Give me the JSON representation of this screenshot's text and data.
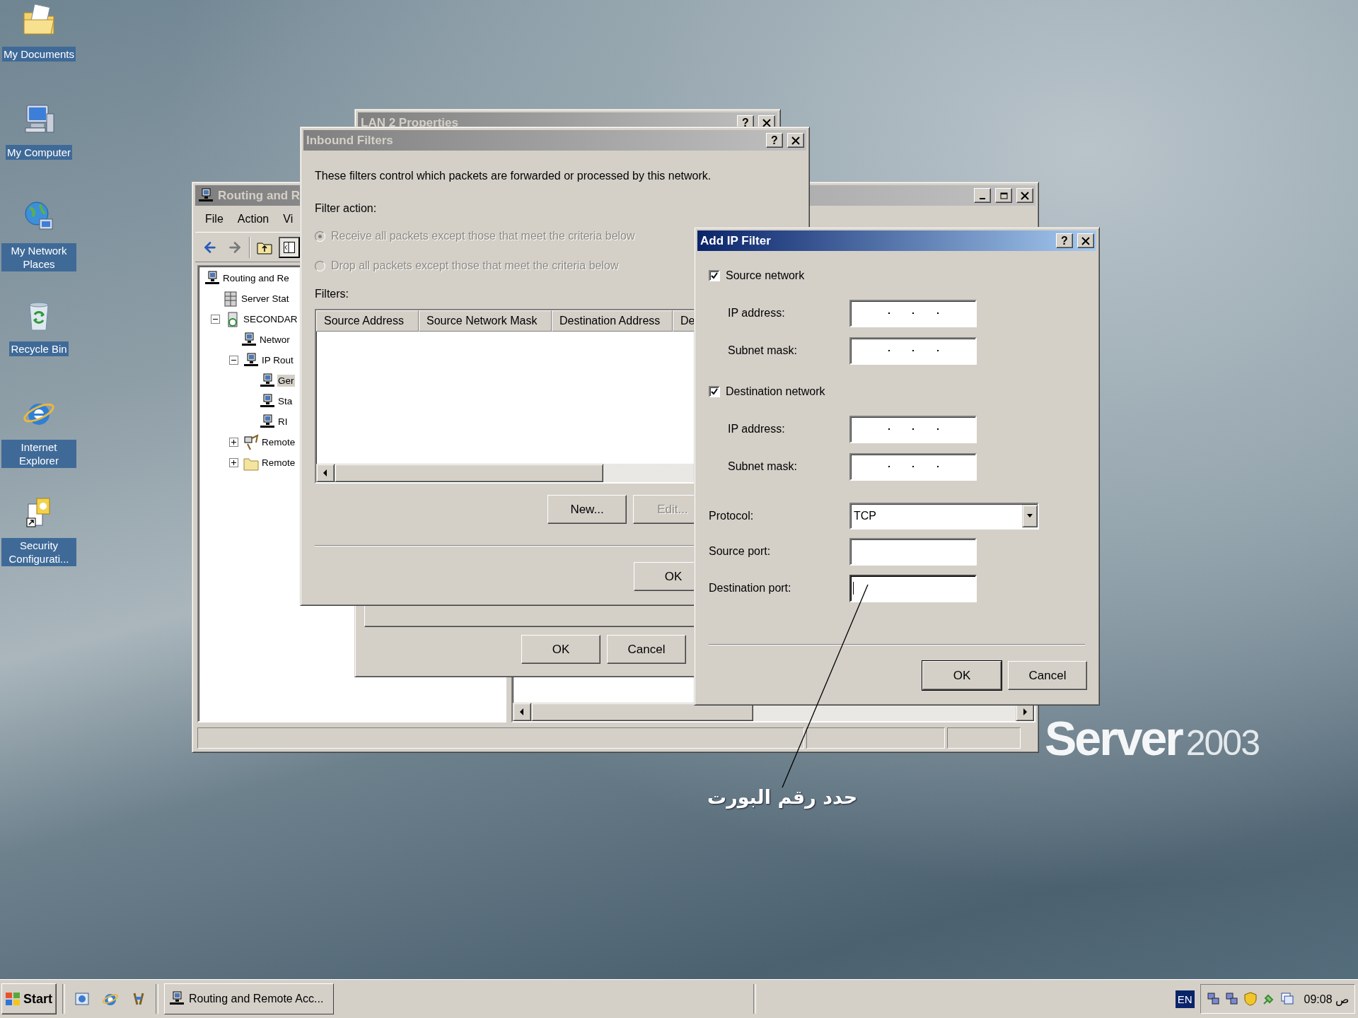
{
  "desktop": {
    "icons": [
      {
        "label": "My Documents",
        "kind": "documents"
      },
      {
        "label": "My Computer",
        "kind": "computer"
      },
      {
        "label": "My Network Places",
        "kind": "network"
      },
      {
        "label": "Recycle Bin",
        "kind": "recycle"
      },
      {
        "label": "Internet Explorer",
        "kind": "browser"
      },
      {
        "label": "Security Configurati...",
        "kind": "security"
      }
    ],
    "brand": {
      "name": "Server",
      "version": "2003"
    }
  },
  "routing_window": {
    "title": "Routing and R",
    "active": false,
    "menu": [
      "File",
      "Action",
      "Vi"
    ],
    "tree": [
      {
        "label": "Routing and Re",
        "kind": "console",
        "selected": false,
        "children": [
          {
            "label": "Server Stat",
            "kind": "servers",
            "selected": false
          },
          {
            "label": "SECONDAR",
            "kind": "server",
            "selected": false,
            "expanded": true,
            "children": [
              {
                "label": "Networ",
                "kind": "console",
                "selected": false
              },
              {
                "label": "IP Rout",
                "kind": "console",
                "selected": false,
                "expanded": true,
                "children": [
                  {
                    "label": "Ger",
                    "kind": "console",
                    "selected": true
                  },
                  {
                    "label": "Sta",
                    "kind": "console",
                    "selected": false
                  },
                  {
                    "label": "RI",
                    "kind": "console",
                    "selected": false
                  }
                ]
              },
              {
                "label": "Remote",
                "kind": "remote",
                "selected": false,
                "expanded": false
              },
              {
                "label": "Remote",
                "kind": "folder",
                "selected": false,
                "expanded": false
              }
            ]
          }
        ]
      }
    ]
  },
  "lan_properties": {
    "title": "LAN 2 Properties",
    "active": false,
    "help": "?",
    "buttons": [
      "OK",
      "Cancel"
    ]
  },
  "inbound_filters": {
    "title": "Inbound Filters",
    "active": false,
    "help": "?",
    "description": "These filters control which packets are forwarded or processed by this network.",
    "filter_action_label": "Filter action:",
    "options": [
      {
        "label": "Receive all packets except those that meet the criteria below",
        "selected": true,
        "disabled": true
      },
      {
        "label": "Drop all packets except those that meet the criteria below",
        "selected": false,
        "disabled": true
      }
    ],
    "filters_label": "Filters:",
    "columns": [
      "Source Address",
      "Source Network Mask",
      "Destination Address",
      "De"
    ],
    "buttons": [
      {
        "label": "New...",
        "disabled": false
      },
      {
        "label": "Edit...",
        "disabled": true
      }
    ],
    "ok": "OK"
  },
  "add_ip_filter": {
    "title": "Add IP Filter",
    "active": true,
    "help": "?",
    "sections": [
      {
        "label": "Source network",
        "checked": true,
        "fields": [
          "IP address:",
          "Subnet mask:"
        ]
      },
      {
        "label": "Destination network",
        "checked": true,
        "fields": [
          "IP address:",
          "Subnet mask:"
        ]
      }
    ],
    "protocol": {
      "label": "Protocol:",
      "value": "TCP"
    },
    "ports": [
      {
        "label": "Source port:",
        "focused": false
      },
      {
        "label": "Destination port:",
        "focused": true
      }
    ],
    "buttons": [
      {
        "label": "OK",
        "default": true
      },
      {
        "label": "Cancel",
        "default": false
      }
    ]
  },
  "annotation": {
    "text": "حدد رقم البورت"
  },
  "taskbar": {
    "start": "Start",
    "tasks": [
      {
        "label": "Routing and Remote Acc...",
        "selected": false
      }
    ],
    "language": "EN",
    "clock": "09:08 ص"
  }
}
